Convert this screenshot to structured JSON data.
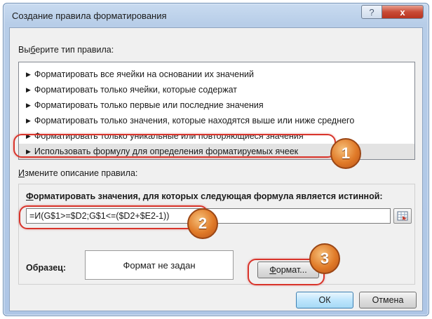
{
  "window": {
    "title": "Создание правила форматирования",
    "help_symbol": "?",
    "close_symbol": "x"
  },
  "rule_type": {
    "label_prefix": "Вы",
    "label_underlined": "б",
    "label_suffix": "ерите тип правила:",
    "items": [
      {
        "label": "Форматировать все ячейки на основании их значений"
      },
      {
        "label": "Форматировать только ячейки, которые содержат"
      },
      {
        "label": "Форматировать только первые или последние значения"
      },
      {
        "label": "Форматировать только значения, которые находятся выше или ниже среднего"
      },
      {
        "label": "Форматировать только уникальные или повторяющиеся значения"
      },
      {
        "label": "Использовать формулу для определения форматируемых ячеек"
      }
    ],
    "selected_index": 5,
    "arrow_symbol": "▶"
  },
  "description": {
    "label_underlined": "И",
    "label_suffix": "змените описание правила:",
    "title_underlined": "Ф",
    "title_suffix": "орматировать значения, для которых следующая формула является истинной:",
    "formula_value": "=И(G$1>=$D2;G$1<=($D2+$E2-1))",
    "sample_label": "Образец:",
    "sample_text": "Формат не задан",
    "format_button_underlined": "Ф",
    "format_button_suffix": "ормат..."
  },
  "buttons": {
    "ok": "ОК",
    "cancel": "Отмена"
  },
  "callouts": [
    "1",
    "2",
    "3"
  ],
  "colors": {
    "callout_ring": "#d9342b",
    "callout_badge": "#e07a28"
  }
}
